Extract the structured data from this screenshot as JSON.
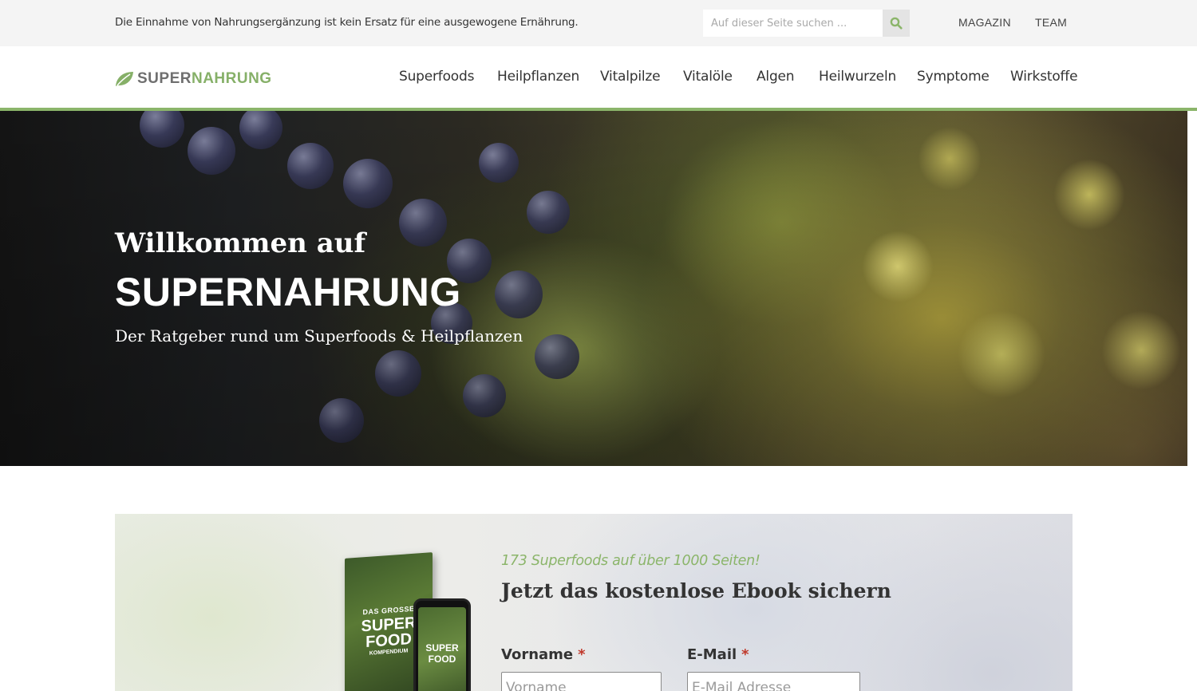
{
  "topbar": {
    "notice": "Die Einnahme von Nahrungsergänzung ist kein Ersatz für eine ausgewogene Ernährung.",
    "search_placeholder": "Auf dieser Seite suchen ...",
    "links": [
      "MAGAZIN",
      "TEAM"
    ]
  },
  "logo": {
    "part1": "SUPER",
    "part2": "NAHRUNG"
  },
  "nav": {
    "items": [
      "Superfoods",
      "Heilpflanzen",
      "Vitalpilze",
      "Vitalöle",
      "Algen",
      "Heilwurzeln",
      "Symptome",
      "Wirkstoffe"
    ]
  },
  "hero": {
    "welcome": "Willkommen auf",
    "title": "SUPERNAHRUNG",
    "subtitle": "Der Ratgeber rund um Superfoods & Heilpflanzen"
  },
  "ebook": {
    "tagline": "173 Superfoods auf über 1000 Seiten!",
    "heading": "Jetzt das kostenlose Ebook sichern",
    "cover_line1": "DAS GROSSE",
    "cover_line2": "SUPER",
    "cover_line3": "FOOD",
    "cover_line4": "KOMPENDIUM",
    "form": {
      "firstname_label": "Vorname",
      "firstname_placeholder": "Vorname",
      "email_label": "E-Mail",
      "email_placeholder": "E-Mail Adresse",
      "required_mark": "*"
    }
  },
  "colors": {
    "accent": "#8bb56a",
    "logo_grey": "#6f6f6f",
    "required": "#c0392b"
  }
}
